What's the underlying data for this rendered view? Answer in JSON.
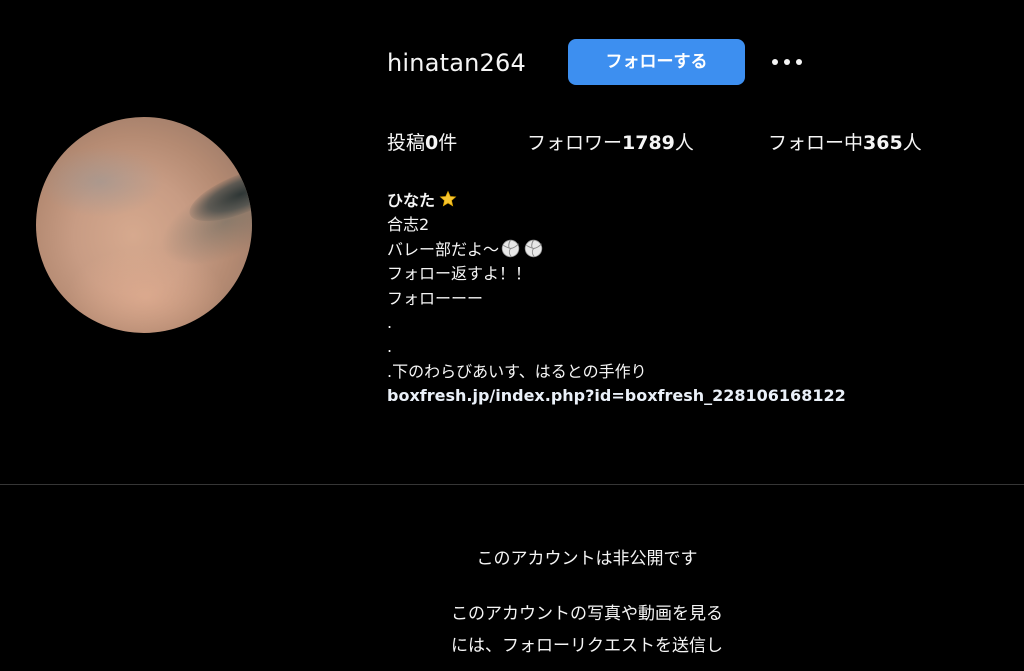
{
  "profile": {
    "username": "hinatan264",
    "follow_label": "フォローする",
    "more_icon": "more-horizontal-icon",
    "avatar": "profile-photo",
    "accent_color": "#3d8ff0"
  },
  "stats": {
    "posts_label": "投稿",
    "posts_value": "0",
    "posts_unit": "件",
    "followers_label": "フォロワー",
    "followers_value": "1789",
    "followers_unit": "人",
    "following_label": "フォロー中",
    "following_value": "365",
    "following_unit": "人"
  },
  "bio": {
    "name": "ひなた",
    "name_icon": "star-icon",
    "lines": [
      "合志2",
      "バレー部だよ〜",
      "フォロー返すよ！！",
      "フォローーー",
      ".",
      ".",
      ".下のわらびあいす、はるとの手作り"
    ],
    "line_icons": [
      "volleyball-icon",
      "volleyball-icon"
    ],
    "link": "boxfresh.jp/index.php?id=boxfresh_228106168122"
  },
  "private": {
    "title": "このアカウントは非公開です",
    "desc_line1": "このアカウントの写真や動画を見る",
    "desc_line2": "には、フォローリクエストを送信し"
  }
}
